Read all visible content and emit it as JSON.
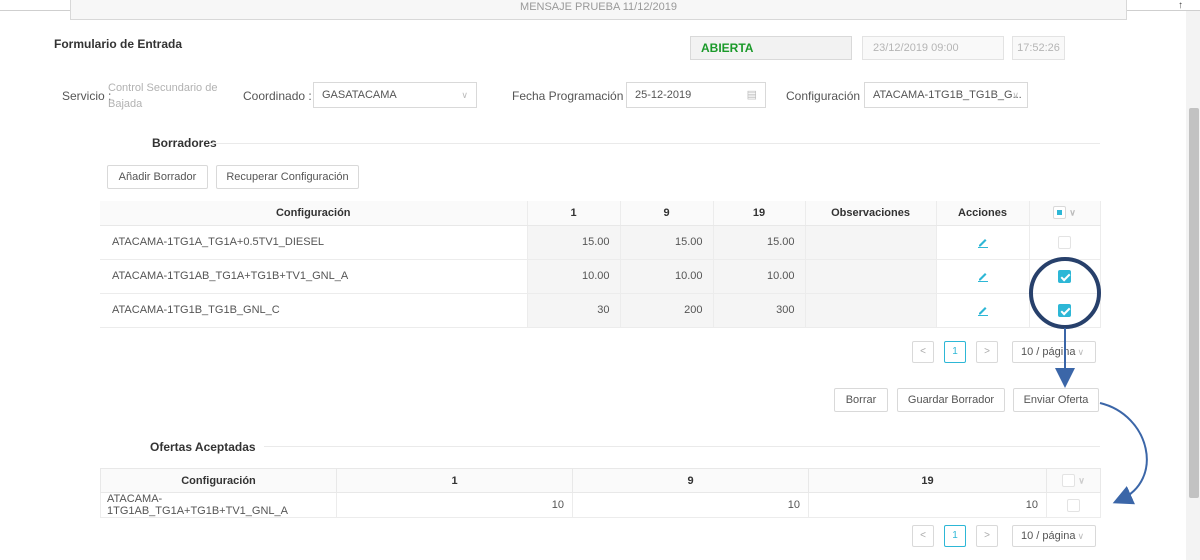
{
  "banner": {
    "text": "MENSAJE PRUEBA 11/12/2019"
  },
  "header": {
    "form_title": "Formulario de Entrada",
    "status": "ABIERTA",
    "date": "23/12/2019   09:00",
    "time": "17:52:26"
  },
  "filters": {
    "servicio_label": "Servicio :",
    "servicio_value": "Control Secundario de Bajada",
    "coordinado_label": "Coordinado :",
    "coordinado_value": "GASATACAMA",
    "fecha_label": "Fecha Programación :",
    "fecha_value": "25-12-2019",
    "config_label": "Configuración :",
    "config_value": "ATACAMA-1TG1B_TG1B_G..."
  },
  "borradores": {
    "title": "Borradores",
    "add_button": "Añadir Borrador",
    "recover_button": "Recuperar Configuración",
    "columns": [
      "Configuración",
      "1",
      "9",
      "19",
      "Observaciones",
      "Acciones"
    ],
    "rows": [
      {
        "config": "ATACAMA-1TG1A_TG1A+0.5TV1_DIESEL",
        "v1": "15.00",
        "v9": "15.00",
        "v19": "15.00",
        "obs": "",
        "checked": false
      },
      {
        "config": "ATACAMA-1TG1AB_TG1A+TG1B+TV1_GNL_A",
        "v1": "10.00",
        "v9": "10.00",
        "v19": "10.00",
        "obs": "",
        "checked": true
      },
      {
        "config": "ATACAMA-1TG1B_TG1B_GNL_C",
        "v1": "30",
        "v9": "200",
        "v19": "300",
        "obs": "",
        "checked": true
      }
    ],
    "page": "1",
    "page_size": "10 / página",
    "delete_button": "Borrar",
    "save_button": "Guardar Borrador",
    "send_button": "Enviar Oferta"
  },
  "aceptadas": {
    "title": "Ofertas Aceptadas",
    "columns": [
      "Configuración",
      "1",
      "9",
      "19"
    ],
    "rows": [
      {
        "config": "ATACAMA-1TG1AB_TG1A+TG1B+TV1_GNL_A",
        "v1": "10",
        "v9": "10",
        "v19": "10"
      }
    ],
    "page": "1",
    "page_size": "10 / página"
  },
  "colors": {
    "accent": "#2db7d6",
    "status_green": "#1b9a2a",
    "annotation_blue": "#3b66a8"
  },
  "icons": [
    "calendar-icon",
    "chevron-down-icon",
    "edit-icon",
    "chevron-left-icon",
    "chevron-right-icon"
  ]
}
